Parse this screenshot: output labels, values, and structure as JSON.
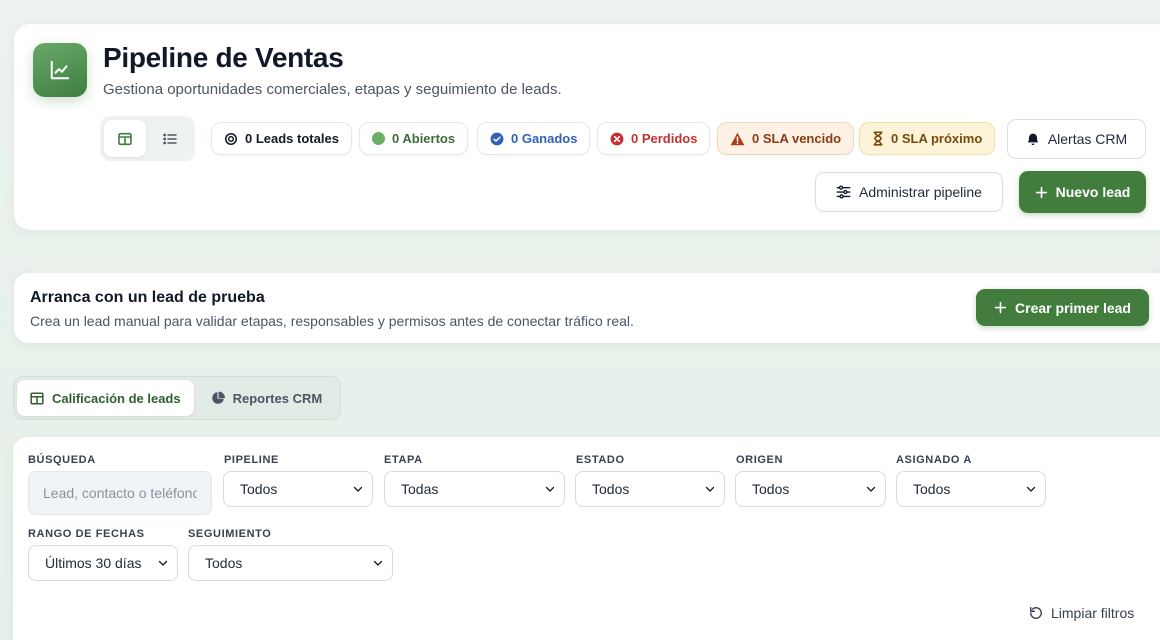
{
  "header": {
    "title": "Pipeline de Ventas",
    "subtitle": "Gestiona oportunidades comerciales, etapas y seguimiento de leads.",
    "stats": {
      "total": "0 Leads totales",
      "open": "0 Abiertos",
      "won": "0 Ganados",
      "lost": "0 Perdidos",
      "sla_overdue": "0 SLA vencido",
      "sla_upcoming": "0 SLA próximo"
    },
    "alerts_label": "Alertas CRM",
    "manage_label": "Administrar pipeline",
    "new_lead_label": "Nuevo lead",
    "colors": {
      "accent": "#427d3d",
      "open": "#6aae6a",
      "won": "#2f62b6",
      "lost": "#c53030"
    }
  },
  "onboarding": {
    "title": "Arranca con un lead de prueba",
    "description": "Crea un lead manual para validar etapas, responsables y permisos antes de conectar tráfico real.",
    "button_label": "Crear primer lead"
  },
  "tabs": [
    {
      "label": "Calificación de leads",
      "icon": "table-icon",
      "active": true
    },
    {
      "label": "Reportes CRM",
      "icon": "pie-chart-icon",
      "active": false
    }
  ],
  "filters": {
    "search": {
      "label": "BÚSQUEDA",
      "placeholder": "Lead, contacto o teléfono"
    },
    "pipeline": {
      "label": "PIPELINE",
      "value": "Todos"
    },
    "stage": {
      "label": "ETAPA",
      "value": "Todas"
    },
    "status": {
      "label": "ESTADO",
      "value": "Todos"
    },
    "origin": {
      "label": "ORIGEN",
      "value": "Todos"
    },
    "assigned": {
      "label": "ASIGNADO A",
      "value": "Todos"
    },
    "date_range": {
      "label": "RANGO DE FECHAS",
      "value": "Últimos 30 días"
    },
    "followup": {
      "label": "SEGUIMIENTO",
      "value": "Todos"
    },
    "clear_label": "Limpiar filtros"
  }
}
